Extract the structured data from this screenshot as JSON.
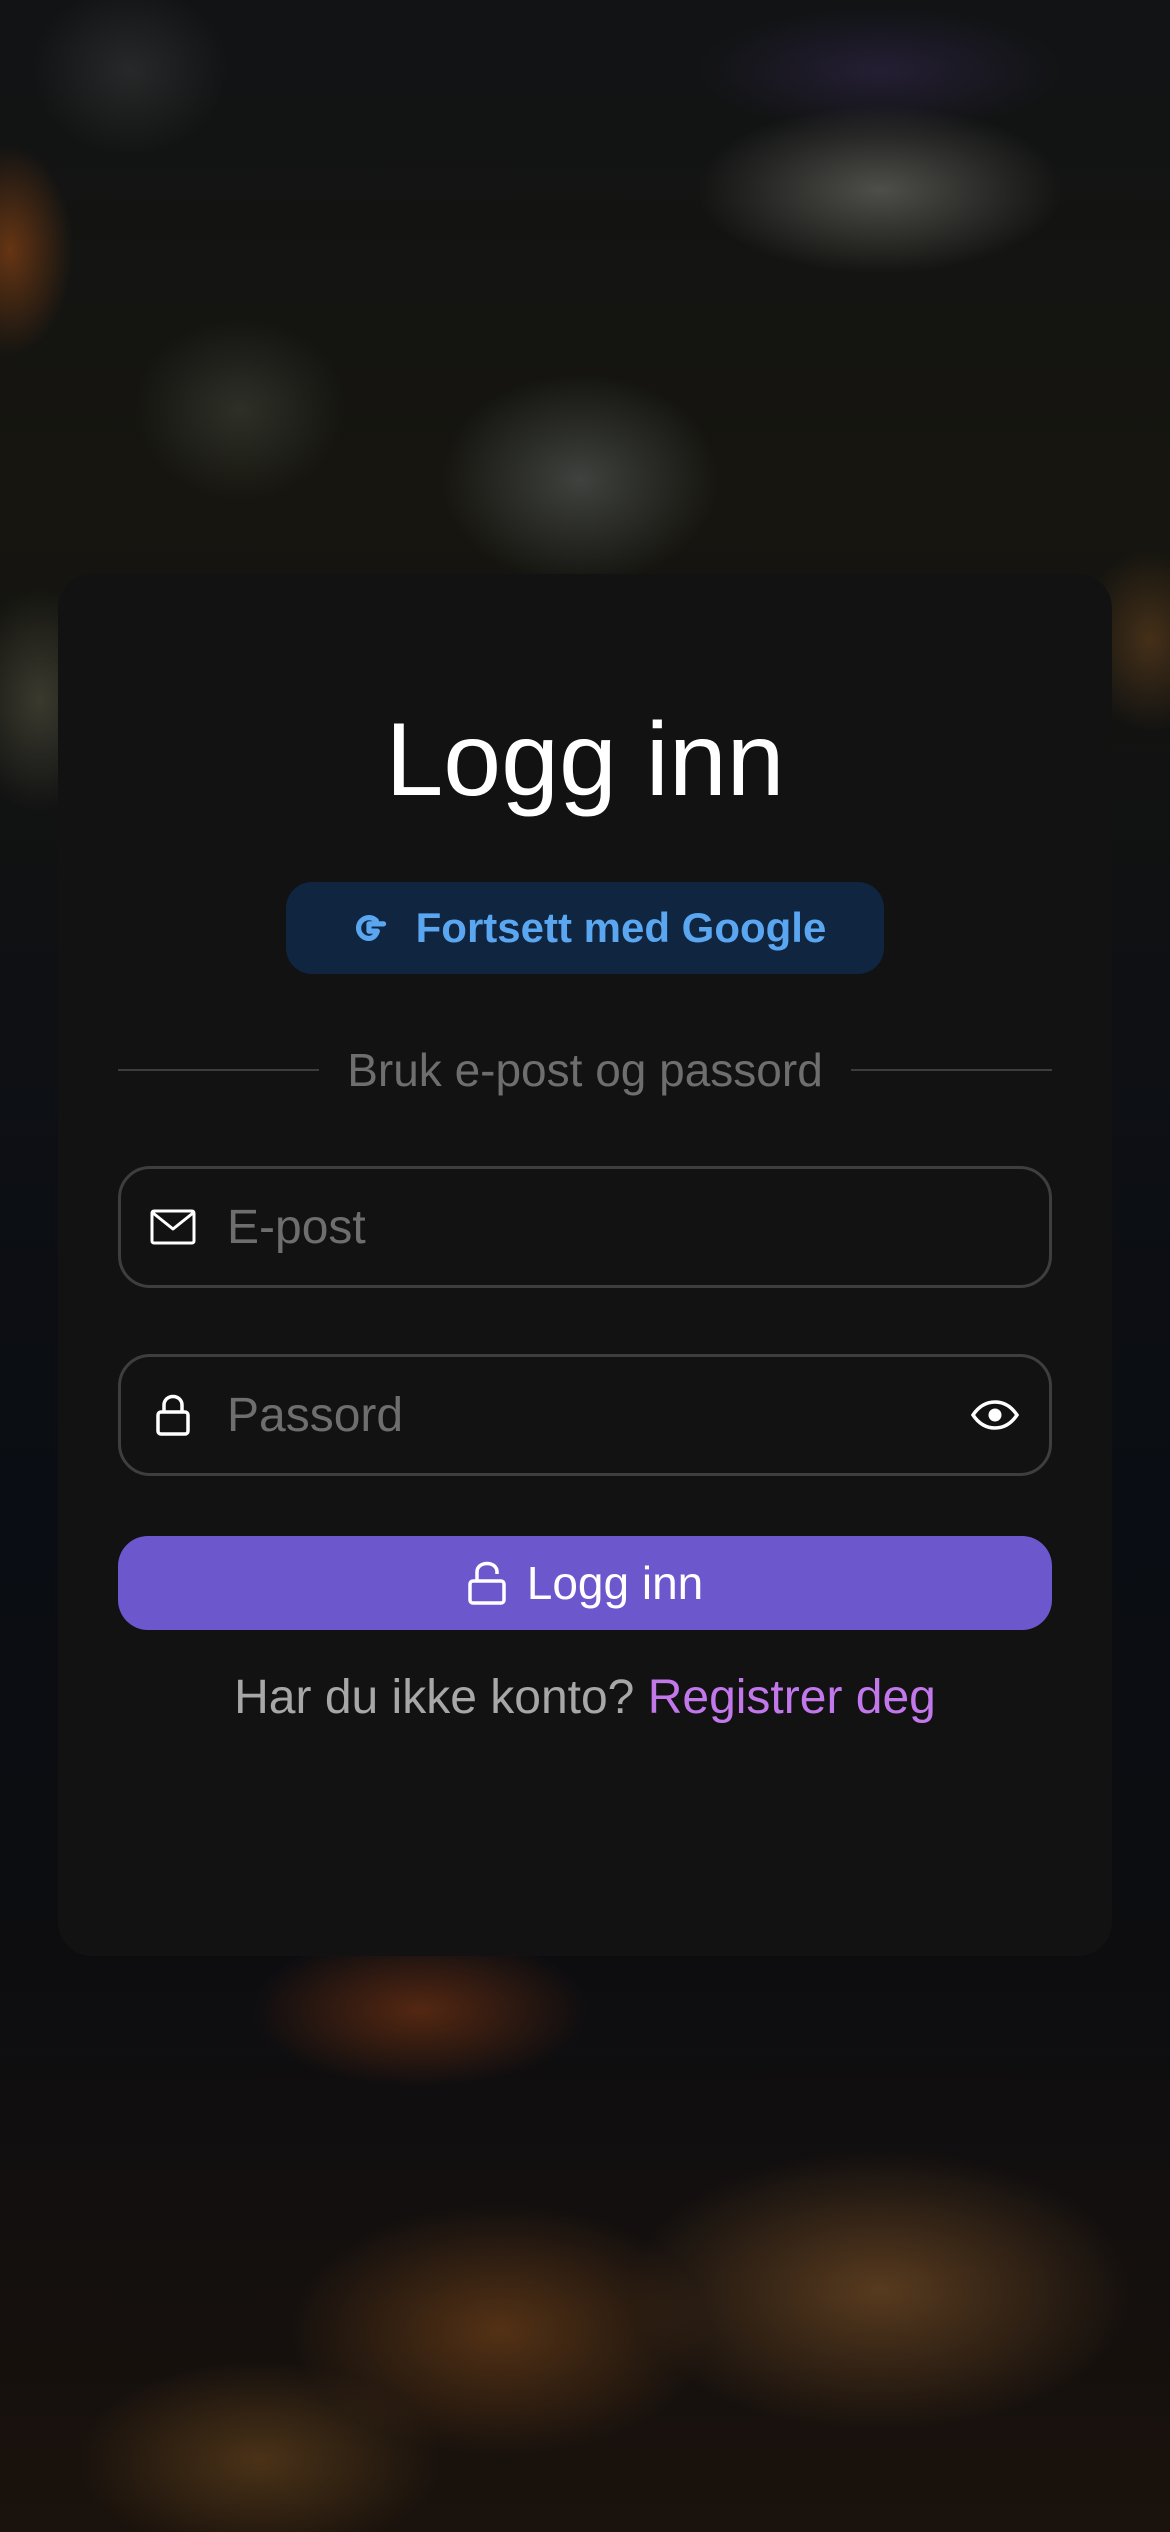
{
  "title": "Logg inn",
  "google_button": {
    "label": "Fortsett med Google",
    "icon": "google-g-icon"
  },
  "divider": {
    "label": "Bruk e-post og passord"
  },
  "email_field": {
    "placeholder": "E-post",
    "value": "",
    "icon": "envelope-icon"
  },
  "password_field": {
    "placeholder": "Passord",
    "value": "",
    "icon": "lock-icon",
    "toggle_icon": "eye-icon"
  },
  "login_button": {
    "label": "Logg inn",
    "icon": "unlock-icon"
  },
  "register": {
    "prompt": "Har du ikke konto?",
    "link": "Registrer deg"
  },
  "colors": {
    "card": "#121212",
    "google_bg": "#0f2540",
    "google_text": "#5aa6f0",
    "primary": "#6d57cc",
    "link": "#c278ea",
    "placeholder": "#6e6e6e"
  }
}
